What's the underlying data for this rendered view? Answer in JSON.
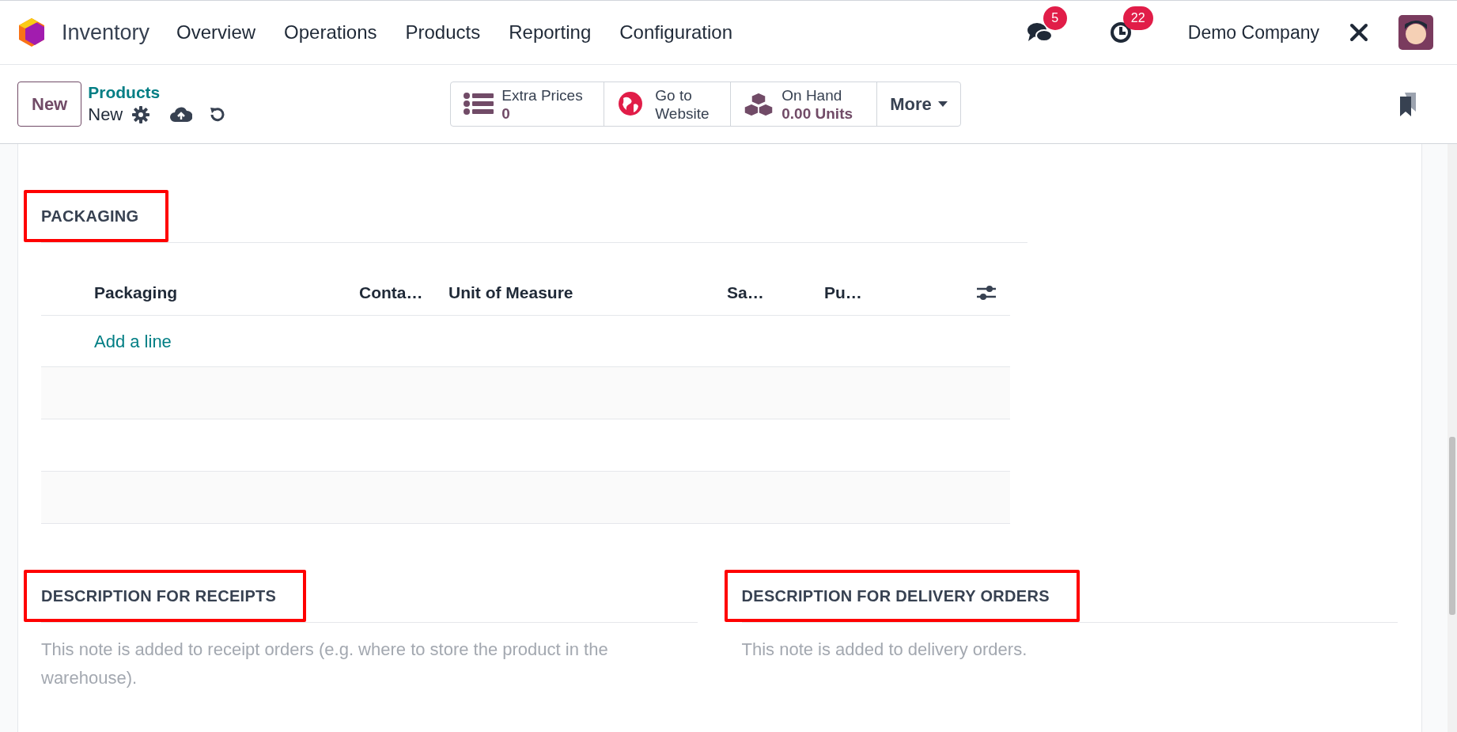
{
  "navbar": {
    "app_name": "Inventory",
    "menu": [
      "Overview",
      "Operations",
      "Products",
      "Reporting",
      "Configuration"
    ],
    "messages_count": "5",
    "activities_count": "22",
    "company": "Demo Company"
  },
  "control_panel": {
    "new_button": "New",
    "breadcrumb": "Products",
    "record_name": "New",
    "smart_buttons": [
      {
        "kind": "list",
        "label": "Extra Prices",
        "value": "0"
      },
      {
        "kind": "globe",
        "label": "Go to Website"
      },
      {
        "kind": "boxes",
        "label": "On Hand",
        "value": "0.00 Units"
      }
    ],
    "more_button": "More"
  },
  "packaging": {
    "title": "PACKAGING",
    "highlighted": true,
    "columns": [
      "Packaging",
      "Conta…",
      "Unit of Measure",
      "Sa…",
      "Pu…"
    ],
    "add_line": "Add a line"
  },
  "descriptions": [
    {
      "title": "DESCRIPTION FOR RECEIPTS",
      "highlighted": true,
      "placeholder": "This note is added to receipt orders (e.g. where to store the product in the warehouse)."
    },
    {
      "title": "DESCRIPTION FOR DELIVERY ORDERS",
      "highlighted": true,
      "placeholder": "This note is added to delivery orders."
    }
  ]
}
